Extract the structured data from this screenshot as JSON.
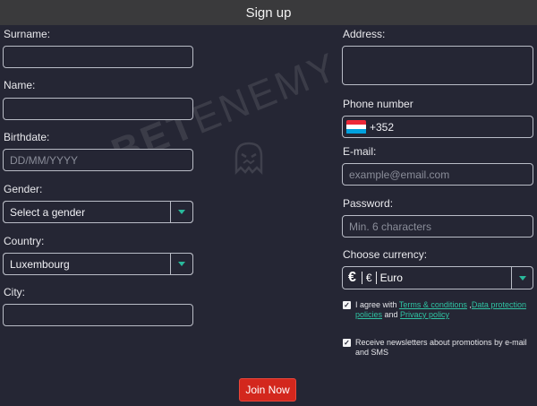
{
  "header": {
    "title": "Sign up"
  },
  "left": {
    "surname_label": "Surname:",
    "name_label": "Name:",
    "birthdate_label": "Birthdate:",
    "birthdate_placeholder": "DD/MM/YYYY",
    "gender_label": "Gender:",
    "gender_value": "Select a gender",
    "country_label": "Country:",
    "country_value": "Luxembourg",
    "city_label": "City:"
  },
  "right": {
    "address_label": "Address:",
    "phone_label": "Phone number",
    "phone_code": "+352",
    "email_label": "E-mail:",
    "email_placeholder": "example@email.com",
    "password_label": "Password:",
    "password_placeholder": "Min. 6 characters",
    "currency_label": "Choose currency:",
    "currency_symbol": "€",
    "currency_symbol_small": "€",
    "currency_name": "Euro"
  },
  "agree": {
    "prefix": "I agree with ",
    "terms": "Terms & conditions",
    "comma": " ,",
    "privacy_data": "Data protection policies",
    "and": " and ",
    "privacy": "Privacy policy",
    "checked": true
  },
  "newsletter": {
    "text": "Receive newsletters about promotions by e-mail and SMS",
    "checked": true
  },
  "join_button": "Join Now",
  "watermark": {
    "part1": "BET",
    "part2": "ENEMY"
  },
  "colors": {
    "background": "#252634",
    "titlebar": "#3a3a3c",
    "accent": "#29b99b",
    "button": "#d3271d"
  },
  "flag_colors": [
    "#ed2939",
    "#ffffff",
    "#00a1de"
  ],
  "icons": {
    "dropdown": "caret-down-icon",
    "flag": "luxembourg-flag-icon",
    "check": "checkmark-icon"
  }
}
